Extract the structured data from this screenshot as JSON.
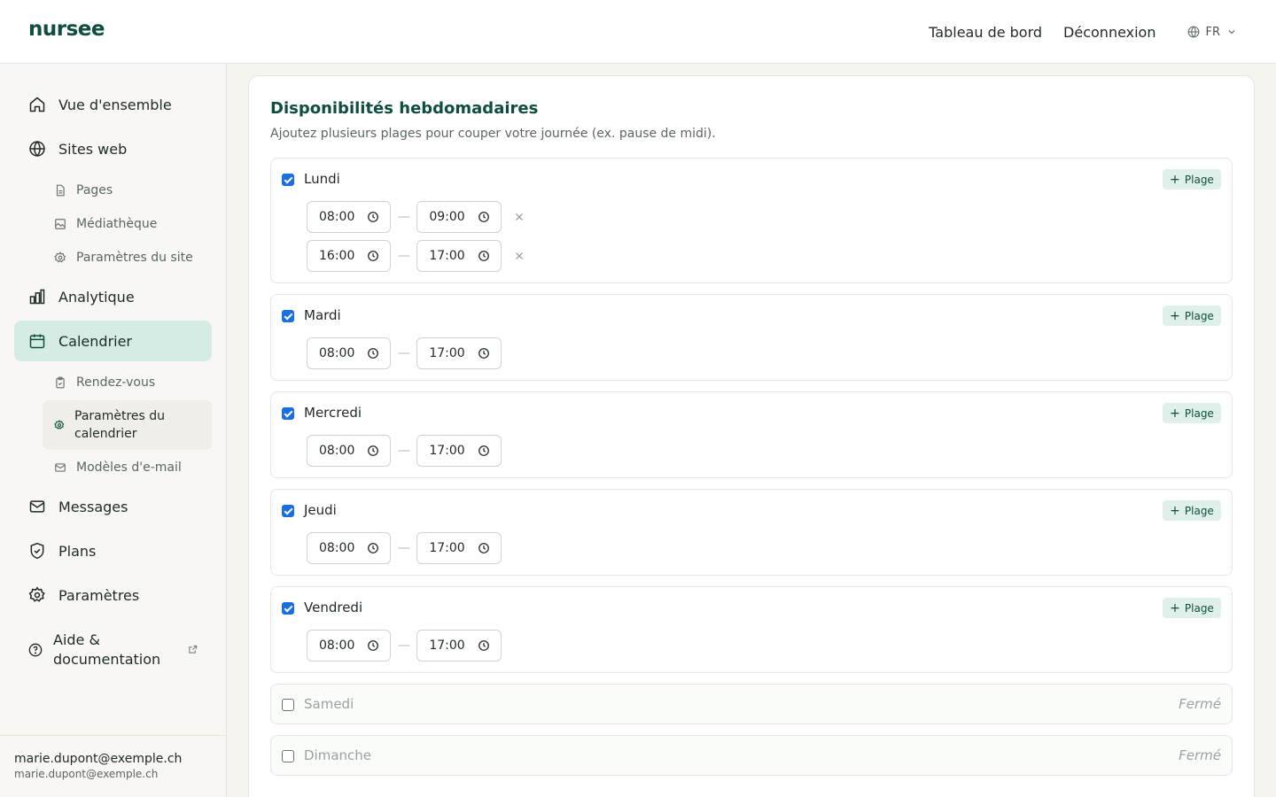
{
  "header": {
    "logo": "nursee",
    "links": {
      "dashboard": "Tableau de bord",
      "logout": "Déconnexion"
    },
    "language": "FR"
  },
  "sidebar": {
    "overview": "Vue d'ensemble",
    "websites": "Sites web",
    "pages": "Pages",
    "media": "Médiathèque",
    "site_settings": "Paramètres du site",
    "analytics": "Analytique",
    "calendar": "Calendrier",
    "appointments": "Rendez-vous",
    "calendar_settings": "Paramètres du calendrier",
    "email_templates": "Modèles d'e-mail",
    "messages": "Messages",
    "plans": "Plans",
    "settings": "Paramètres",
    "help": "Aide & documentation"
  },
  "user": {
    "name": "marie.dupont@exemple.ch",
    "email": "marie.dupont@exemple.ch"
  },
  "availability": {
    "title": "Disponibilités hebdomadaires",
    "subtitle": "Ajoutez plusieurs plages pour couper votre journée (ex. pause de midi).",
    "add_label": "Plage",
    "closed_label": "Fermé",
    "days": [
      {
        "name": "Lundi",
        "enabled": true,
        "slots": [
          {
            "start": "08:00",
            "end": "09:00"
          },
          {
            "start": "16:00",
            "end": "17:00"
          }
        ]
      },
      {
        "name": "Mardi",
        "enabled": true,
        "slots": [
          {
            "start": "08:00",
            "end": "17:00"
          }
        ]
      },
      {
        "name": "Mercredi",
        "enabled": true,
        "slots": [
          {
            "start": "08:00",
            "end": "17:00"
          }
        ]
      },
      {
        "name": "Jeudi",
        "enabled": true,
        "slots": [
          {
            "start": "08:00",
            "end": "17:00"
          }
        ]
      },
      {
        "name": "Vendredi",
        "enabled": true,
        "slots": [
          {
            "start": "08:00",
            "end": "17:00"
          }
        ]
      },
      {
        "name": "Samedi",
        "enabled": false,
        "slots": []
      },
      {
        "name": "Dimanche",
        "enabled": false,
        "slots": []
      }
    ]
  },
  "colors": {
    "brand": "#0e4d3f",
    "active_nav": "#d5ece5",
    "checkbox": "#1a6fe0",
    "add_button_bg": "#dff0ea"
  }
}
